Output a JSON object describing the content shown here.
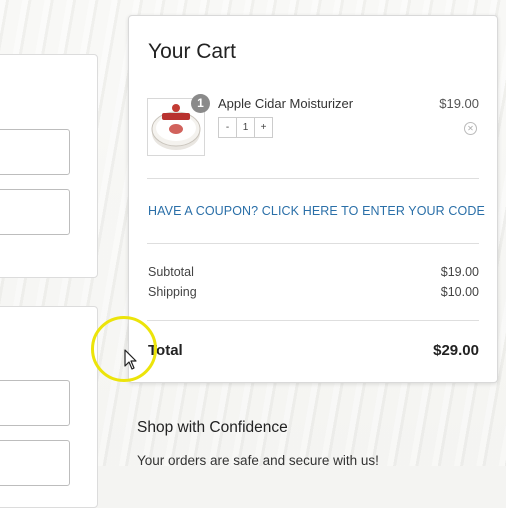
{
  "cart": {
    "title": "Your Cart",
    "item": {
      "name": "Apple Cidar Moisturizer",
      "price": "$19.00",
      "badge_count": "1",
      "stepper": {
        "minus": "-",
        "value": "1",
        "plus": "+"
      },
      "remove_icon": "close-circle-icon"
    },
    "coupon_link": "HAVE A COUPON? CLICK HERE TO ENTER YOUR CODE",
    "subtotal": {
      "label": "Subtotal",
      "value": "$19.00"
    },
    "shipping": {
      "label": "Shipping",
      "value": "$10.00"
    },
    "total": {
      "label": "Total",
      "value": "$29.00"
    }
  },
  "confidence": {
    "title": "Shop with Confidence",
    "text": "Your orders are safe and secure with us!"
  },
  "colors": {
    "link": "#2a6fa8",
    "cursor_highlight": "#ece40a",
    "badge": "#8a8a8a"
  }
}
